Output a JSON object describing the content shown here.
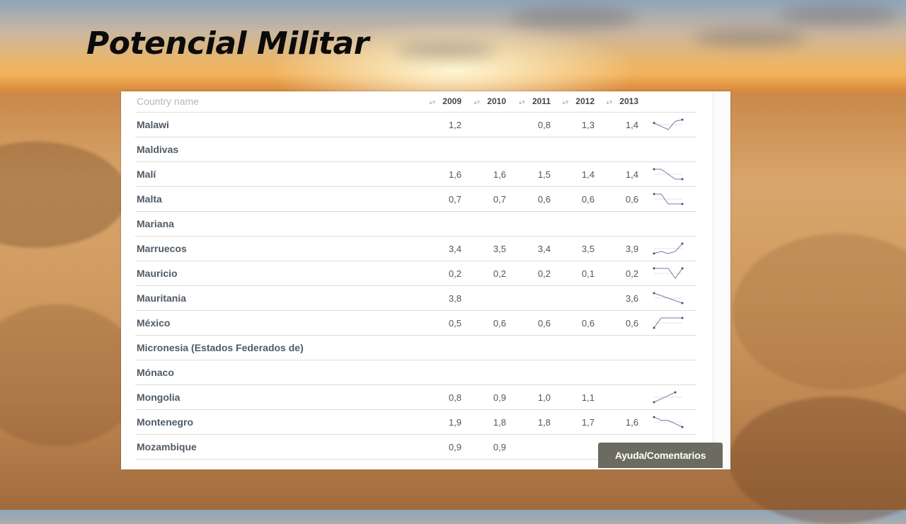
{
  "slide": {
    "title": "Potencial Militar"
  },
  "table": {
    "columns": [
      "Country name",
      "2009",
      "2010",
      "2011",
      "2012",
      "2013"
    ],
    "rows": [
      {
        "name": "Malawi",
        "values": [
          "1,2",
          "",
          "0,8",
          "1,3",
          "1,4"
        ]
      },
      {
        "name": "Maldivas",
        "values": [
          "",
          "",
          "",
          "",
          ""
        ]
      },
      {
        "name": "Malí",
        "values": [
          "1,6",
          "1,6",
          "1,5",
          "1,4",
          "1,4"
        ]
      },
      {
        "name": "Malta",
        "values": [
          "0,7",
          "0,7",
          "0,6",
          "0,6",
          "0,6"
        ]
      },
      {
        "name": "Mariana",
        "values": [
          "",
          "",
          "",
          "",
          ""
        ]
      },
      {
        "name": "Marruecos",
        "values": [
          "3,4",
          "3,5",
          "3,4",
          "3,5",
          "3,9"
        ]
      },
      {
        "name": "Mauricio",
        "values": [
          "0,2",
          "0,2",
          "0,2",
          "0,1",
          "0,2"
        ]
      },
      {
        "name": "Mauritania",
        "values": [
          "3,8",
          "",
          "",
          "",
          "3,6"
        ]
      },
      {
        "name": "México",
        "values": [
          "0,5",
          "0,6",
          "0,6",
          "0,6",
          "0,6"
        ]
      },
      {
        "name": "Micronesia (Estados Federados de)",
        "values": [
          "",
          "",
          "",
          "",
          ""
        ]
      },
      {
        "name": "Mónaco",
        "values": [
          "",
          "",
          "",
          "",
          ""
        ]
      },
      {
        "name": "Mongolia",
        "values": [
          "0,8",
          "0,9",
          "1,0",
          "1,1",
          ""
        ]
      },
      {
        "name": "Montenegro",
        "values": [
          "1,9",
          "1,8",
          "1,8",
          "1,7",
          "1,6"
        ]
      },
      {
        "name": "Mozambique",
        "values": [
          "0,9",
          "0,9",
          "",
          "",
          ""
        ]
      }
    ]
  },
  "help_button": {
    "label": "Ayuda/Comentarios"
  },
  "icons": {
    "sort": "sort-arrows-icon",
    "sparkline": "sparkline-icon"
  },
  "colors": {
    "button_bg": "#6b6b5f",
    "sparkline": "#6d7fa3"
  }
}
